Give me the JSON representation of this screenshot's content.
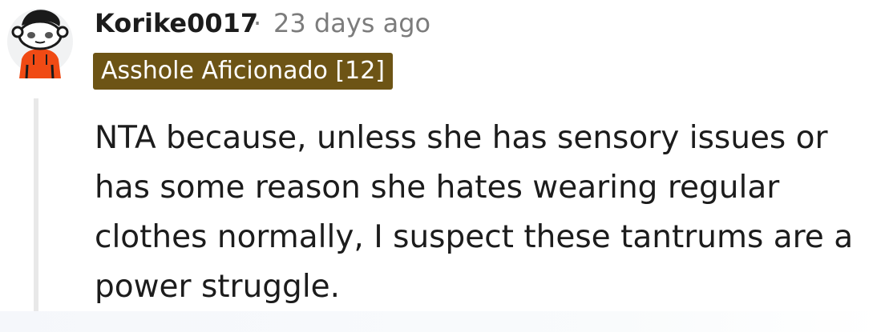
{
  "comment": {
    "username": "Korike0017",
    "separator": "·",
    "timestamp": "23 days ago",
    "flair": "Asshole Aficionado [12]",
    "body": "NTA because, unless she has sensory issues or has some reason she hates wearing regular clothes normally, I suspect these tantrums are a power struggle."
  },
  "colors": {
    "flair_bg": "#6d5415",
    "text": "#1c1c1c",
    "muted": "#7c7c7c",
    "avatar_hoodie": "#f04a14"
  },
  "icons": {
    "avatar": "snoo-avatar-icon"
  }
}
